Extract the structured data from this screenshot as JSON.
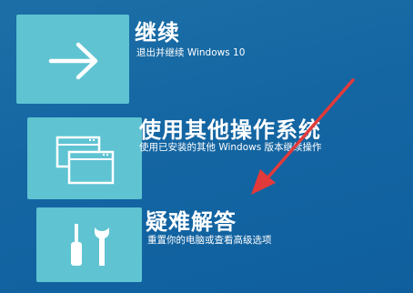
{
  "options": [
    {
      "title": "继续",
      "description": "退出并继续 Windows 10",
      "icon": "arrow-right-icon"
    },
    {
      "title": "使用其他操作系统",
      "description": "使用已安装的其他 Windows 版本继续操作",
      "icon": "windows-stack-icon"
    },
    {
      "title": "疑难解答",
      "description": "重置你的电脑或查看高级选项",
      "icon": "tools-icon"
    }
  ],
  "colors": {
    "background": "#1466a3",
    "tile": "#5fc3d2",
    "annotation_arrow": "#e23a3a"
  }
}
